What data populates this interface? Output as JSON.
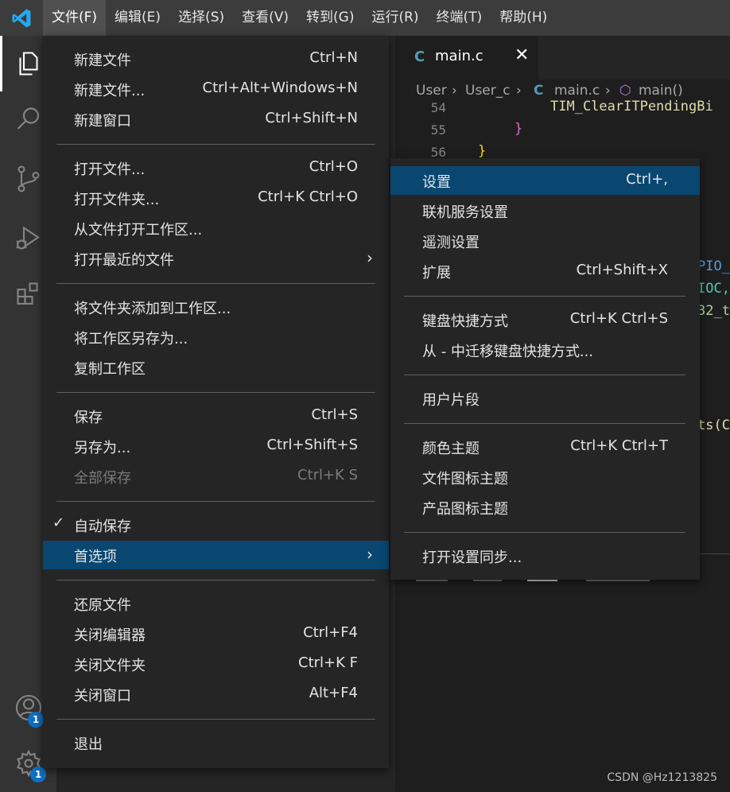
{
  "menubar": {
    "items": [
      "文件(F)",
      "编辑(E)",
      "选择(S)",
      "查看(V)",
      "转到(G)",
      "运行(R)",
      "终端(T)",
      "帮助(H)"
    ],
    "active": "文件(F)"
  },
  "activity_bar": {
    "icons": [
      "files-icon",
      "search-icon",
      "source-control-icon",
      "run-debug-icon",
      "extensions-icon",
      "account-icon",
      "settings-gear-icon"
    ],
    "account_badge": "1",
    "settings_badge": "1"
  },
  "editor": {
    "tab_icon": "C",
    "tab_title": "main.c",
    "tab_close": "✕",
    "breadcrumbs": [
      "User",
      "User_c",
      "main.c",
      "main()"
    ],
    "code_lines": [
      {
        "num": "54",
        "text": "TIM_ClearITPendingBi"
      },
      {
        "num": "55",
        "text": "}"
      },
      {
        "num": "56",
        "text": "}"
      }
    ],
    "code_fragments": [
      "PIO_",
      "IOC,",
      "32_t",
      "ts(C"
    ]
  },
  "file_menu": {
    "groups": [
      [
        {
          "label": "新建文件",
          "shortcut": "Ctrl+N"
        },
        {
          "label": "新建文件...",
          "shortcut": "Ctrl+Alt+Windows+N"
        },
        {
          "label": "新建窗口",
          "shortcut": "Ctrl+Shift+N"
        }
      ],
      [
        {
          "label": "打开文件...",
          "shortcut": "Ctrl+O"
        },
        {
          "label": "打开文件夹...",
          "shortcut": "Ctrl+K Ctrl+O"
        },
        {
          "label": "从文件打开工作区...",
          "shortcut": ""
        },
        {
          "label": "打开最近的文件",
          "shortcut": "",
          "submenu": true
        }
      ],
      [
        {
          "label": "将文件夹添加到工作区...",
          "shortcut": ""
        },
        {
          "label": "将工作区另存为...",
          "shortcut": ""
        },
        {
          "label": "复制工作区",
          "shortcut": ""
        }
      ],
      [
        {
          "label": "保存",
          "shortcut": "Ctrl+S"
        },
        {
          "label": "另存为...",
          "shortcut": "Ctrl+Shift+S"
        },
        {
          "label": "全部保存",
          "shortcut": "Ctrl+K S",
          "disabled": true
        }
      ],
      [
        {
          "label": "自动保存",
          "shortcut": "",
          "checked": true
        },
        {
          "label": "首选项",
          "shortcut": "",
          "submenu": true,
          "highlighted": true
        }
      ],
      [
        {
          "label": "还原文件",
          "shortcut": ""
        },
        {
          "label": "关闭编辑器",
          "shortcut": "Ctrl+F4"
        },
        {
          "label": "关闭文件夹",
          "shortcut": "Ctrl+K F"
        },
        {
          "label": "关闭窗口",
          "shortcut": "Alt+F4"
        }
      ],
      [
        {
          "label": "退出",
          "shortcut": ""
        }
      ]
    ]
  },
  "preferences_submenu": {
    "groups": [
      [
        {
          "label": "设置",
          "shortcut": "Ctrl+,",
          "highlighted": true
        },
        {
          "label": "联机服务设置",
          "shortcut": ""
        },
        {
          "label": "遥测设置",
          "shortcut": ""
        },
        {
          "label": "扩展",
          "shortcut": "Ctrl+Shift+X"
        }
      ],
      [
        {
          "label": "键盘快捷方式",
          "shortcut": "Ctrl+K Ctrl+S"
        },
        {
          "label": "从 - 中迁移键盘快捷方式...",
          "shortcut": ""
        }
      ],
      [
        {
          "label": "用户片段",
          "shortcut": ""
        }
      ],
      [
        {
          "label": "颜色主题",
          "shortcut": "Ctrl+K Ctrl+T"
        },
        {
          "label": "文件图标主题",
          "shortcut": ""
        },
        {
          "label": "产品图标主题",
          "shortcut": ""
        }
      ],
      [
        {
          "label": "打开设置同步...",
          "shortcut": ""
        }
      ]
    ]
  },
  "symbols": {
    "submenu_arrow": "›",
    "check": "✓",
    "crumb_sep": "›",
    "method_icon": "⬡"
  },
  "watermark": "CSDN @Hz1213825"
}
